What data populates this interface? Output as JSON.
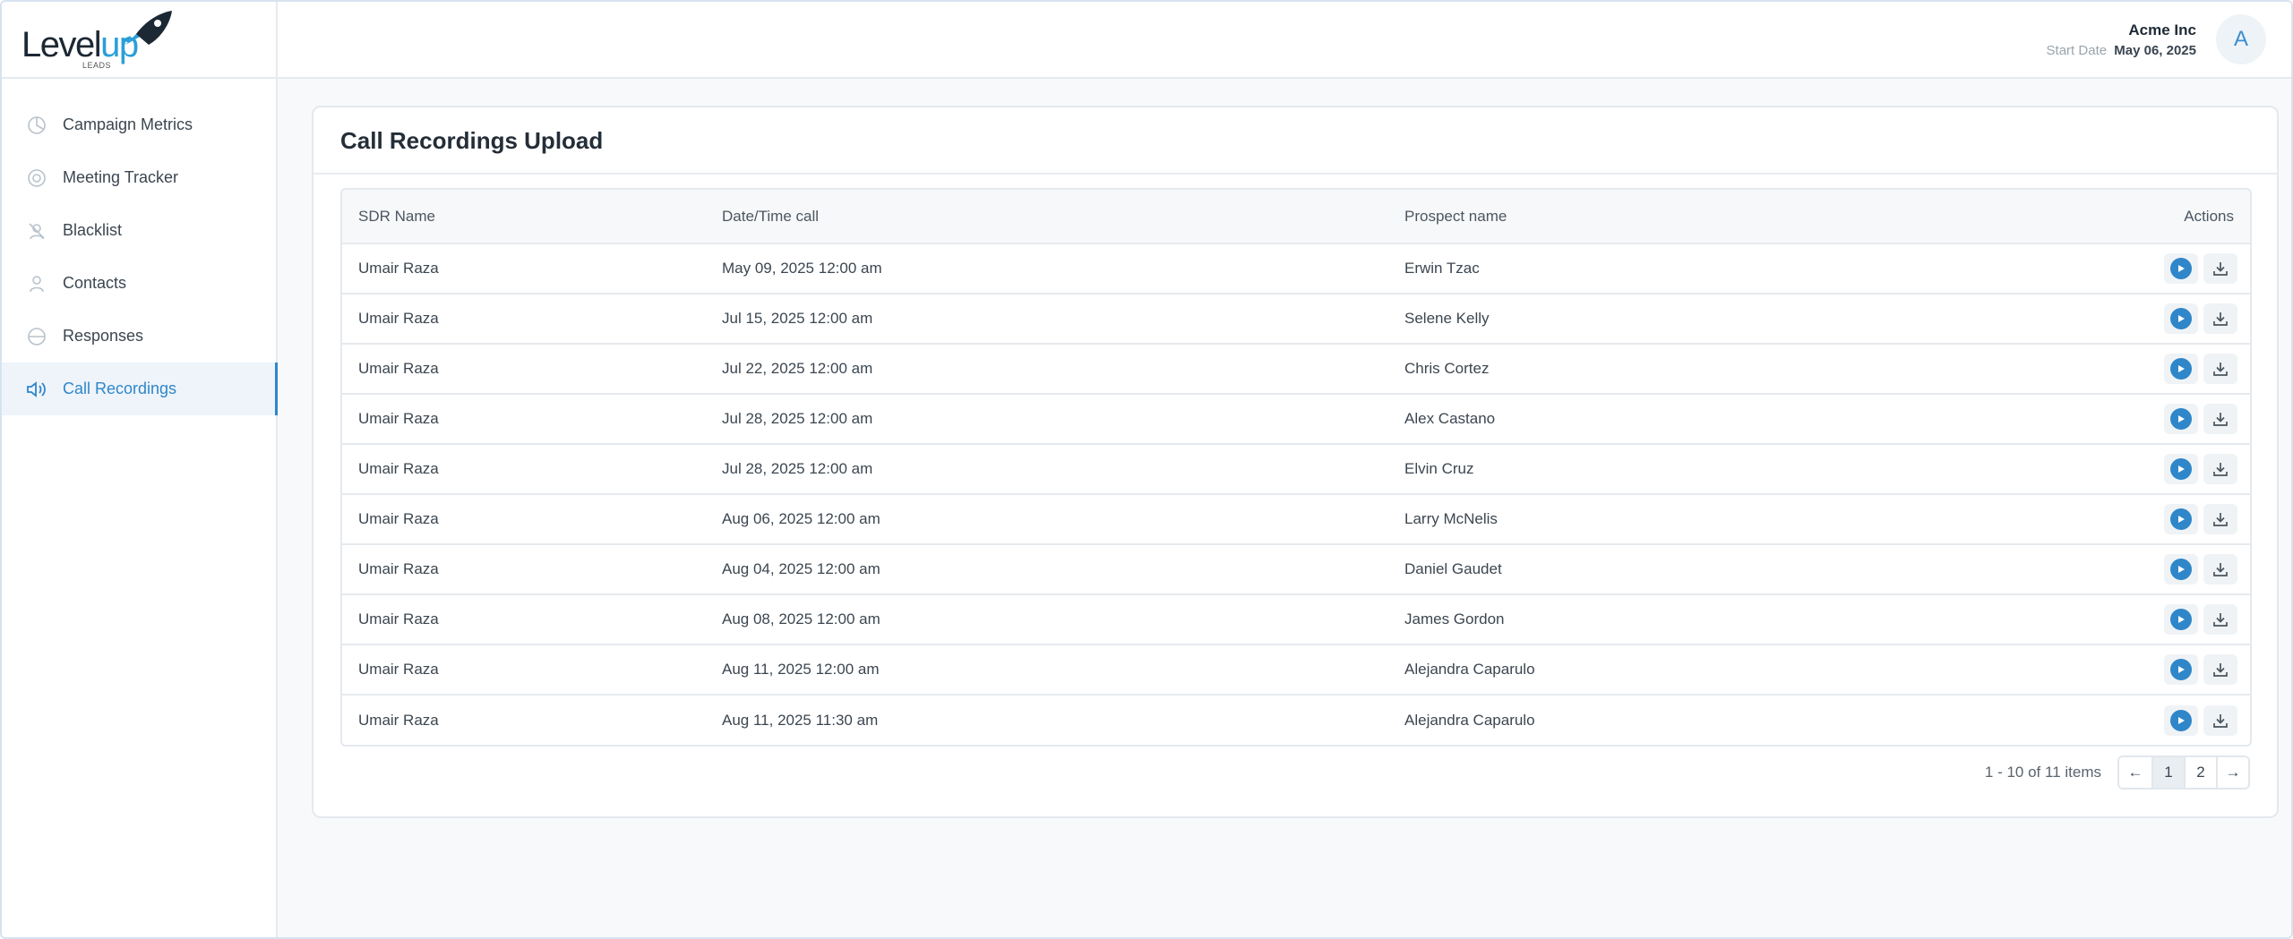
{
  "brand": {
    "logo_main": "Level",
    "logo_accent": "up",
    "logo_sub": "LEADS"
  },
  "sidebar": {
    "items": [
      {
        "label": "Campaign Metrics",
        "icon": "chart-circle-icon",
        "active": false
      },
      {
        "label": "Meeting Tracker",
        "icon": "target-icon",
        "active": false
      },
      {
        "label": "Blacklist",
        "icon": "blocked-user-icon",
        "active": false
      },
      {
        "label": "Contacts",
        "icon": "user-icon",
        "active": false
      },
      {
        "label": "Responses",
        "icon": "minus-circle-icon",
        "active": false
      },
      {
        "label": "Call Recordings",
        "icon": "speaker-icon",
        "active": true
      }
    ]
  },
  "header": {
    "company": "Acme Inc",
    "start_label": "Start Date",
    "start_date": "May 06, 2025",
    "avatar_initial": "A"
  },
  "main": {
    "title": "Call Recordings Upload",
    "columns": [
      "SDR Name",
      "Date/Time call",
      "Prospect name",
      "Actions"
    ],
    "rows": [
      {
        "sdr": "Umair Raza",
        "datetime": "May 09, 2025 12:00 am",
        "prospect": "Erwin Tzac"
      },
      {
        "sdr": "Umair Raza",
        "datetime": "Jul 15, 2025 12:00 am",
        "prospect": "Selene Kelly"
      },
      {
        "sdr": "Umair Raza",
        "datetime": "Jul 22, 2025 12:00 am",
        "prospect": "Chris Cortez"
      },
      {
        "sdr": "Umair Raza",
        "datetime": "Jul 28, 2025 12:00 am",
        "prospect": "Alex Castano"
      },
      {
        "sdr": "Umair Raza",
        "datetime": "Jul 28, 2025 12:00 am",
        "prospect": "Elvin Cruz"
      },
      {
        "sdr": "Umair Raza",
        "datetime": "Aug 06, 2025 12:00 am",
        "prospect": "Larry McNelis"
      },
      {
        "sdr": "Umair Raza",
        "datetime": "Aug 04, 2025 12:00 am",
        "prospect": "Daniel Gaudet"
      },
      {
        "sdr": "Umair Raza",
        "datetime": "Aug 08, 2025 12:00 am",
        "prospect": "James Gordon"
      },
      {
        "sdr": "Umair Raza",
        "datetime": "Aug 11, 2025 12:00 am",
        "prospect": "Alejandra Caparulo"
      },
      {
        "sdr": "Umair Raza",
        "datetime": "Aug 11, 2025 11:30 am",
        "prospect": "Alejandra Caparulo"
      }
    ],
    "row_actions": [
      "play-icon",
      "download-icon"
    ]
  },
  "pagination": {
    "info": "1 - 10 of 11 items",
    "prev": "←",
    "pages": [
      "1",
      "2"
    ],
    "current": "1",
    "next": "→"
  },
  "colors": {
    "accent": "#2f86c9",
    "logo_accent": "#2a9fd6"
  }
}
